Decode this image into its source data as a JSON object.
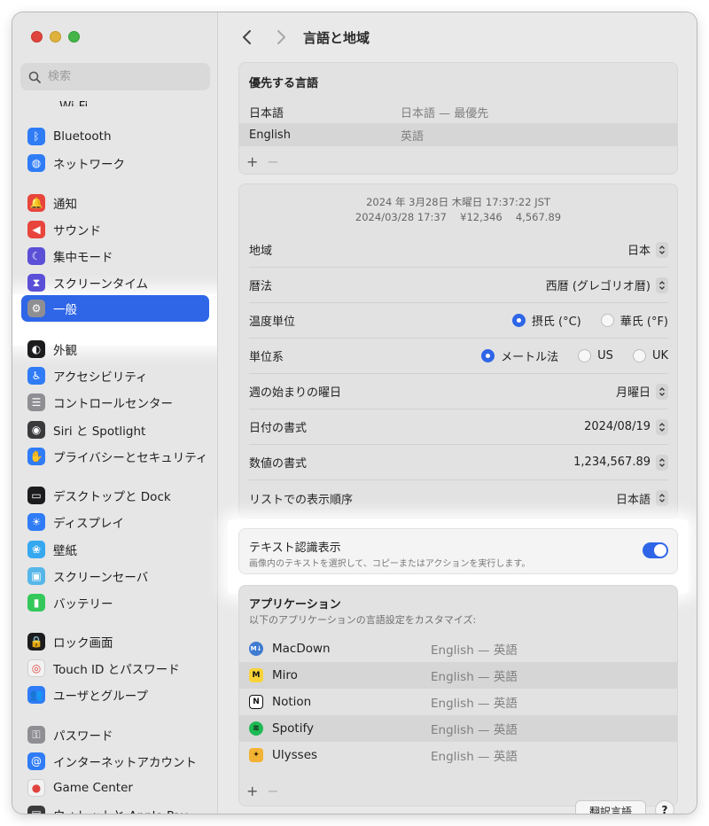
{
  "search": {
    "placeholder": "検索"
  },
  "sidebar": {
    "partial_top_label": "Wi-Fi",
    "items": [
      {
        "label": "Bluetooth",
        "icon": "bluetooth-icon",
        "color": "#2f7cf6"
      },
      {
        "label": "ネットワーク",
        "icon": "globe-icon",
        "color": "#2f7cf6"
      },
      {
        "label": "通知",
        "icon": "bell-icon",
        "color": "#e8453c"
      },
      {
        "label": "サウンド",
        "icon": "speaker-icon",
        "color": "#e8453c"
      },
      {
        "label": "集中モード",
        "icon": "moon-icon",
        "color": "#5a4fd6"
      },
      {
        "label": "スクリーンタイム",
        "icon": "hourglass-icon",
        "color": "#5a4fd6"
      },
      {
        "label": "一般",
        "icon": "gear-icon",
        "color": "#8e8e93"
      },
      {
        "label": "外観",
        "icon": "appearance-icon",
        "color": "#1c1c1e"
      },
      {
        "label": "アクセシビリティ",
        "icon": "accessibility-icon",
        "color": "#2f7cf6"
      },
      {
        "label": "コントロールセンター",
        "icon": "toggles-icon",
        "color": "#8e8e93"
      },
      {
        "label": "Siri と Spotlight",
        "icon": "siri-icon",
        "color": "#3a3a3c"
      },
      {
        "label": "プライバシーとセキュリティ",
        "icon": "hand-icon",
        "color": "#2f7cf6"
      },
      {
        "label": "デスクトップと Dock",
        "icon": "dock-icon",
        "color": "#1c1c1e"
      },
      {
        "label": "ディスプレイ",
        "icon": "sun-icon",
        "color": "#2f7cf6"
      },
      {
        "label": "壁紙",
        "icon": "flower-icon",
        "color": "#35a8f0"
      },
      {
        "label": "スクリーンセーバ",
        "icon": "screensaver-icon",
        "color": "#56b6e8"
      },
      {
        "label": "バッテリー",
        "icon": "battery-icon",
        "color": "#34c759"
      },
      {
        "label": "ロック画面",
        "icon": "lock-icon",
        "color": "#1c1c1e"
      },
      {
        "label": "Touch ID とパスワード",
        "icon": "fingerprint-icon",
        "color": "#f2f2f2"
      },
      {
        "label": "ユーザとグループ",
        "icon": "users-icon",
        "color": "#2f7cf6"
      },
      {
        "label": "パスワード",
        "icon": "key-icon",
        "color": "#8e8e93"
      },
      {
        "label": "インターネットアカウント",
        "icon": "at-icon",
        "color": "#2f7cf6"
      },
      {
        "label": "Game Center",
        "icon": "gamecenter-icon",
        "color": "#f2f2f2"
      },
      {
        "label": "ウォレットと Apple Pay",
        "icon": "wallet-icon",
        "color": "#3a3a3c"
      }
    ]
  },
  "header": {
    "title": "言語と地域"
  },
  "preferred": {
    "heading": "優先する言語",
    "rows": [
      {
        "name": "日本語",
        "detail": "日本語 — 最優先"
      },
      {
        "name": "English",
        "detail": "英語"
      }
    ],
    "add": "+",
    "remove": "−"
  },
  "region": {
    "preview_line1": "2024 年 3月28日 木曜日 17:37:22 JST",
    "preview_line2": "2024/03/28 17:37　 ¥12,346　 4,567.89",
    "region_label": "地域",
    "region_value": "日本",
    "calendar_label": "暦法",
    "calendar_value": "西暦 (グレゴリオ暦)",
    "temp_label": "温度単位",
    "temp_c": "摂氏 (°C)",
    "temp_f": "華氏 (°F)",
    "units_label": "単位系",
    "units_metric": "メートル法",
    "units_us": "US",
    "units_uk": "UK",
    "week_label": "週の始まりの曜日",
    "week_value": "月曜日",
    "date_label": "日付の書式",
    "date_value": "2024/08/19",
    "number_label": "数値の書式",
    "number_value": "1,234,567.89",
    "sort_label": "リストでの表示順序",
    "sort_value": "日本語"
  },
  "live_text": {
    "title": "テキスト認識表示",
    "subtitle": "画像内のテキストを選択して、コピーまたはアクションを実行します。",
    "enabled": true
  },
  "apps": {
    "heading": "アプリケーション",
    "subheading": "以下のアプリケーションの言語設定をカスタマイズ:",
    "rows": [
      {
        "name": "MacDown",
        "lang": "English — 英語"
      },
      {
        "name": "Miro",
        "lang": "English — 英語"
      },
      {
        "name": "Notion",
        "lang": "English — 英語"
      },
      {
        "name": "Spotify",
        "lang": "English — 英語"
      },
      {
        "name": "Ulysses",
        "lang": "English — 英語"
      }
    ],
    "add": "+",
    "remove": "−"
  },
  "footer": {
    "translate_button": "翻訳言語",
    "help": "?"
  }
}
